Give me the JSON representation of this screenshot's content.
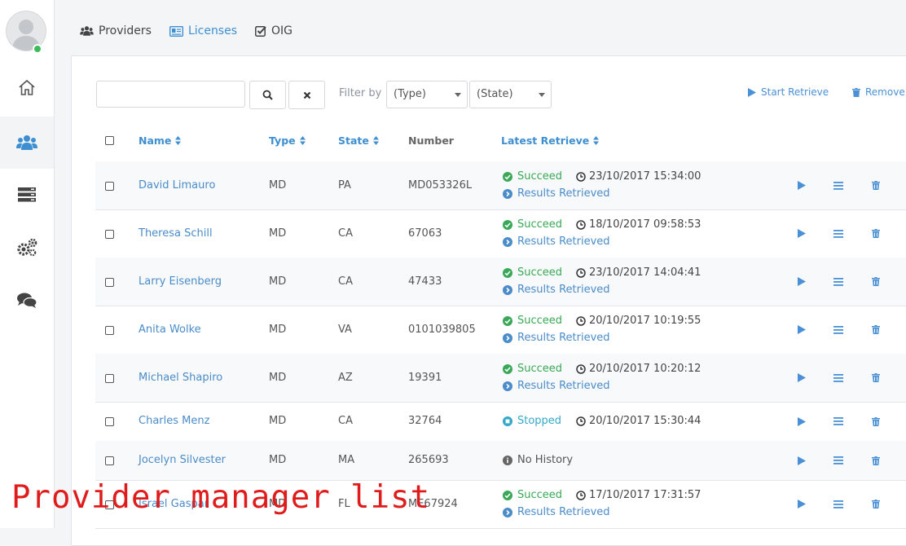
{
  "tabs": [
    {
      "label": "Providers",
      "icon": "users-icon"
    },
    {
      "label": "Licenses",
      "icon": "id-card-icon"
    },
    {
      "label": "OIG",
      "icon": "check-square-icon"
    }
  ],
  "sidebar": {
    "items": [
      "home-icon",
      "users-icon",
      "server-icon",
      "cogs-icon",
      "comments-icon"
    ],
    "active": "users-icon"
  },
  "toolbar": {
    "search_placeholder": "",
    "filter_label": "Filter by",
    "type_select": "(Type)",
    "state_select": "(State)",
    "start_retrieve": "Start Retrieve",
    "remove": "Remove"
  },
  "table": {
    "headers": {
      "name": "Name",
      "type": "Type",
      "state": "State",
      "number": "Number",
      "latest": "Latest Retrieve"
    },
    "rows": [
      {
        "name": "David  Limauro",
        "type": "MD",
        "state": "PA",
        "number": "MD053326L",
        "status": "Succeed",
        "timestamp": "23/10/2017 15:34:00",
        "result": "Results Retrieved"
      },
      {
        "name": "Theresa  Schill",
        "type": "MD",
        "state": "CA",
        "number": "67063",
        "status": "Succeed",
        "timestamp": "18/10/2017 09:58:53",
        "result": "Results Retrieved"
      },
      {
        "name": "Larry  Eisenberg",
        "type": "MD",
        "state": "CA",
        "number": "47433",
        "status": "Succeed",
        "timestamp": "23/10/2017 14:04:41",
        "result": "Results Retrieved"
      },
      {
        "name": "Anita  Wolke",
        "type": "MD",
        "state": "VA",
        "number": "0101039805",
        "status": "Succeed",
        "timestamp": "20/10/2017 10:19:55",
        "result": "Results Retrieved"
      },
      {
        "name": "Michael  Shapiro",
        "type": "MD",
        "state": "AZ",
        "number": "19391",
        "status": "Succeed",
        "timestamp": "20/10/2017 10:20:12",
        "result": "Results Retrieved"
      },
      {
        "name": "Charles  Menz",
        "type": "MD",
        "state": "CA",
        "number": "32764",
        "status": "Stopped",
        "timestamp": "20/10/2017 15:30:44",
        "result": ""
      },
      {
        "name": "Jocelyn  Silvester",
        "type": "MD",
        "state": "MA",
        "number": "265693",
        "status": "No History",
        "timestamp": "",
        "result": ""
      },
      {
        "name": "Israel  Gaspar",
        "type": "MD",
        "state": "FL",
        "number": "ME67924",
        "status": "Succeed",
        "timestamp": "17/10/2017 17:31:57",
        "result": "Results Retrieved"
      }
    ]
  },
  "watermark": "Provider manager list",
  "colors": {
    "accent": "#3d8fd1",
    "success": "#3aa857",
    "stopped": "#34a8c8",
    "online": "#3cbb5b"
  }
}
